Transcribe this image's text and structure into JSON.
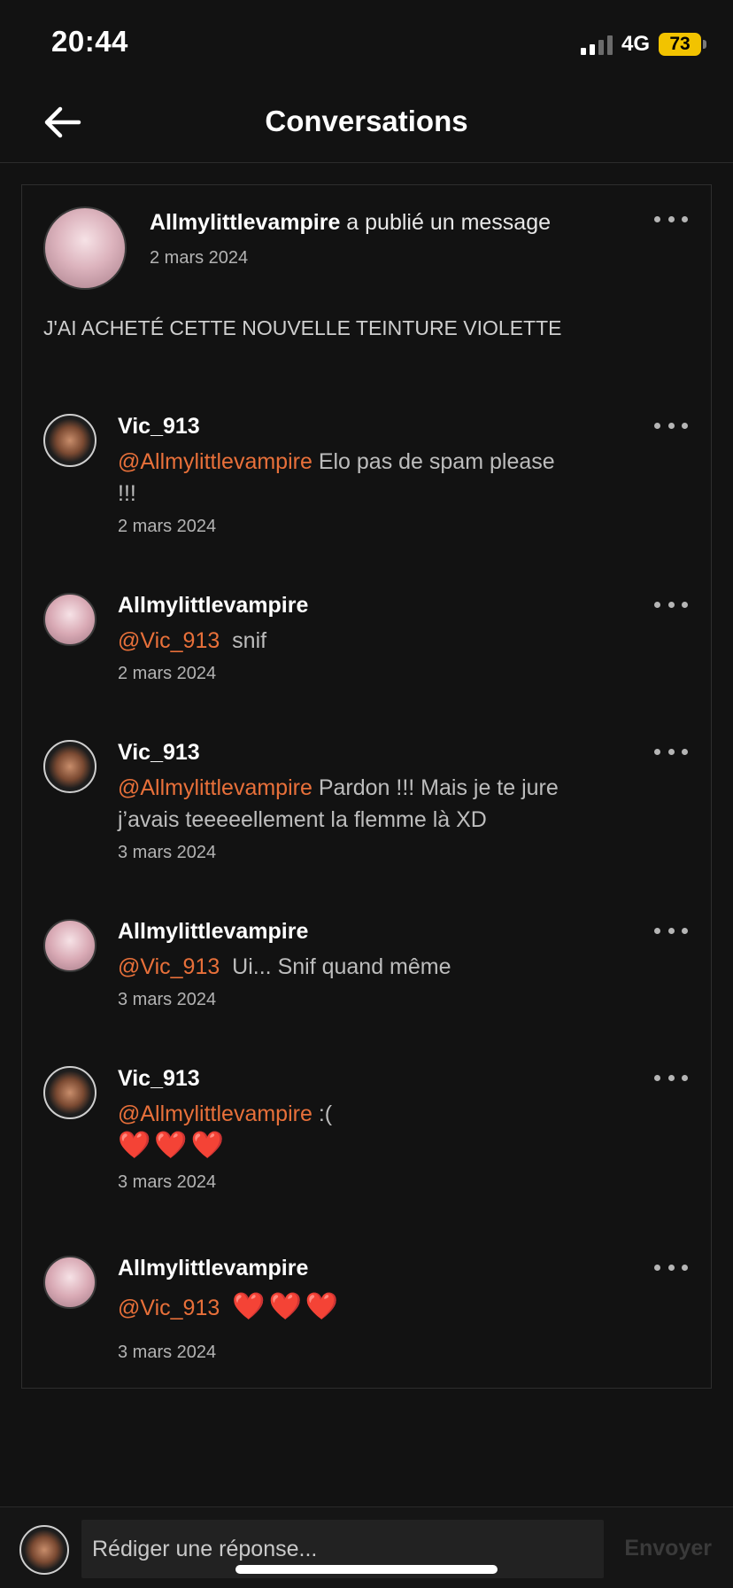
{
  "status_bar": {
    "time": "20:44",
    "network": "4G",
    "battery": "73"
  },
  "header": {
    "title": "Conversations",
    "back_icon": "arrow-left-icon"
  },
  "post": {
    "author": "Allmylittlevampire",
    "action": " a publié un message",
    "date": "2 mars 2024",
    "body": "J'AI ACHETÉ CETTE NOUVELLE TEINTURE VIOLETTE"
  },
  "comments": [
    {
      "author": "Vic_913",
      "mention": "@Allmylittlevampire",
      "text": " Elo pas de spam please !!!",
      "hearts": "",
      "date": "2 mars 2024"
    },
    {
      "author": "Allmylittlevampire",
      "mention": "@Vic_913",
      "text": "  snif",
      "hearts": "",
      "date": "2 mars 2024"
    },
    {
      "author": "Vic_913",
      "mention": "@Allmylittlevampire",
      "text": " Pardon !!! Mais je te jure j’avais teeeeellement la flemme là XD",
      "hearts": "",
      "date": "3 mars 2024"
    },
    {
      "author": "Allmylittlevampire",
      "mention": "@Vic_913",
      "text": "  Ui... Snif quand même",
      "hearts": "",
      "date": "3 mars 2024"
    },
    {
      "author": "Vic_913",
      "mention": "@Allmylittlevampire",
      "text": " :(",
      "hearts": "❤️❤️❤️",
      "date": "3 mars 2024"
    },
    {
      "author": "Allmylittlevampire",
      "mention": "@Vic_913",
      "text": "  ",
      "hearts": "❤️❤️❤️",
      "date": "3 mars 2024"
    }
  ],
  "reply": {
    "placeholder": "Rédiger une réponse...",
    "send_label": "Envoyer"
  },
  "colors": {
    "background": "#121212",
    "mention": "#e8703a",
    "text_muted": "#bdbdbd"
  }
}
